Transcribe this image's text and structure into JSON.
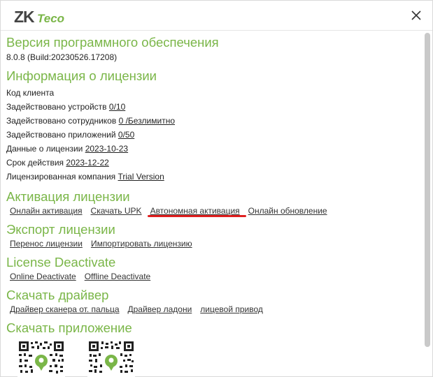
{
  "brand": {
    "logo_text": "ZKTeco",
    "accent_color": "#7ab648",
    "highlight_color": "#e02020"
  },
  "header": {
    "close_icon": "close-icon"
  },
  "software": {
    "title": "Версия программного обеспечения",
    "version": "8.0.8 (Build:20230526.17208)"
  },
  "license": {
    "title": "Информация о лицензии",
    "rows": [
      {
        "label": "Код клиента",
        "value": ""
      },
      {
        "label": "Задействовано устройств",
        "value": "0/10"
      },
      {
        "label": "Задействовано сотрудников",
        "value": "0 /Безлимитно"
      },
      {
        "label": "Задействовано приложений",
        "value": "0/50"
      },
      {
        "label": "Данные о лицензии",
        "value": "2023-10-23"
      },
      {
        "label": "Срок действия",
        "value": "2023-12-22"
      },
      {
        "label": "Лицензированная компания",
        "value": "Trial Version"
      }
    ]
  },
  "activation": {
    "title": "Активация лицензии",
    "links": [
      "Онлайн активация",
      "Скачать UPK",
      "Автономная активация",
      "Онлайн обновление"
    ]
  },
  "export": {
    "title": "Экспорт лицензии",
    "links": [
      "Перенос лицензии",
      "Импортировать лицензию"
    ]
  },
  "deactivate": {
    "title": "License Deactivate",
    "links": [
      "Online Deactivate",
      "Offline Deactivate"
    ]
  },
  "driver": {
    "title": "Скачать драйвер",
    "links": [
      "Драйвер сканера от. пальца",
      "Драйвер ладони",
      "лицевой привод"
    ]
  },
  "app": {
    "title": "Скачать приложение"
  }
}
